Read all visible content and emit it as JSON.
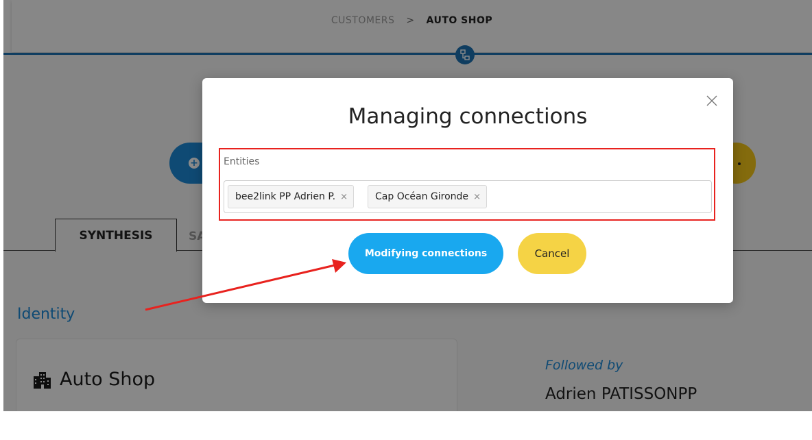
{
  "breadcrumb": {
    "parent": "CUSTOMERS",
    "separator": ">",
    "current": "AUTO SHOP"
  },
  "tabs": [
    {
      "label": "SYNTHESIS",
      "active": true
    },
    {
      "label": "SA",
      "active": false
    }
  ],
  "identity": {
    "section_title": "Identity",
    "company_name": "Auto Shop",
    "followed_label": "Followed by",
    "followed_name": "Adrien PATISSONPP"
  },
  "modal": {
    "title": "Managing connections",
    "entities_label": "Entities",
    "tags": [
      {
        "label": "bee2link PP Adrien P.",
        "remove": "×"
      },
      {
        "label": "Cap Océan Gironde",
        "remove": "×"
      }
    ],
    "primary_button": "Modifying connections",
    "secondary_button": "Cancel"
  },
  "colors": {
    "primary_blue": "#19a8ef",
    "header_blue": "#1c6fb0",
    "cancel_yellow": "#f5d345",
    "annotation_red": "#e8221e"
  },
  "icons": [
    "network-icon",
    "close-icon",
    "building-icon",
    "plus-icon"
  ]
}
